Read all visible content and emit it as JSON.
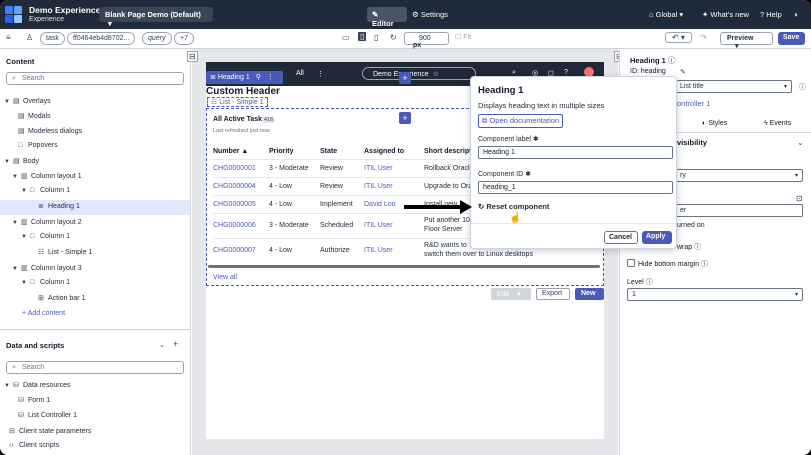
{
  "app": {
    "title": "Demo Experience",
    "subtitle": "Experience"
  },
  "topbar": {
    "page_select": "Blank Page Demo (Default)",
    "editor_label": "Editor",
    "settings_label": "Settings",
    "global_label": "Global",
    "whats_new_label": "What's new",
    "help_label": "Help"
  },
  "toolbar": {
    "pills": [
      "task",
      "ff0464eb4d8702...",
      "query",
      "+7"
    ],
    "zoom_value": "900",
    "zoom_unit": "px",
    "fit_label": "Fit",
    "preview_label": "Preview",
    "save_label": "Save"
  },
  "left_panel": {
    "content_heading": "Content",
    "search_placeholder": "Search",
    "tree": [
      {
        "label": "Overlays"
      },
      {
        "label": "Modals"
      },
      {
        "label": "Modeless dialogs"
      },
      {
        "label": "Popovers"
      },
      {
        "label": "Body"
      },
      {
        "label": "Column layout 1"
      },
      {
        "label": "Column 1"
      },
      {
        "label": "Heading 1"
      },
      {
        "label": "Column layout 2"
      },
      {
        "label": "Column 1"
      },
      {
        "label": "List - Simple 1"
      },
      {
        "label": "Column layout 3"
      },
      {
        "label": "Column 1"
      },
      {
        "label": "Action bar 1"
      }
    ],
    "add_content": "Add content",
    "data_heading": "Data and scripts",
    "data_search_placeholder": "Search",
    "data_tree": [
      {
        "label": "Data resources"
      },
      {
        "label": "Form 1"
      },
      {
        "label": "List Controller 1"
      },
      {
        "label": "Client state parameters"
      },
      {
        "label": "Client scripts"
      }
    ]
  },
  "canvas": {
    "header_text": "Custom Header",
    "nav_all": "All",
    "nav_pill": "Demo Experience",
    "sel_toolbar_label": "Heading 1",
    "list_label": "List - Simple 1",
    "table_title": "All Active Tasks",
    "table_count": "416",
    "refreshed": "Last refreshed just now",
    "columns": [
      "Number",
      "Priority",
      "State",
      "Assigned to",
      "Short descript"
    ],
    "rows": [
      {
        "number": "CHG0000001",
        "priority": "3 - Moderate",
        "state": "Review",
        "assigned": "ITIL User",
        "desc": "Rollback Oracle"
      },
      {
        "number": "CHG0000004",
        "priority": "4 - Low",
        "state": "Review",
        "assigned": "ITIL User",
        "desc": "Upgrade to Ora"
      },
      {
        "number": "CHG0000005",
        "priority": "4 - Low",
        "state": "Implement",
        "assigned": "David Loo",
        "desc": "Install new"
      },
      {
        "number": "CHG0000006",
        "priority": "3 - Moderate",
        "state": "Scheduled",
        "assigned": "ITIL User",
        "desc": "Put another 10",
        "desc2": "Floor Server"
      },
      {
        "number": "CHG0000007",
        "priority": "4 - Low",
        "state": "Authorize",
        "assigned": "ITIL User",
        "desc": "R&D wants to",
        "desc2": "switch them over to Linux desktops"
      }
    ],
    "view_all": "View all",
    "edit_label": "Edit",
    "export_label": "Export",
    "new_label": "New"
  },
  "right_panel": {
    "title": "Heading 1",
    "id_label": "ID: heading",
    "style_select": "List title",
    "list_controller": "ontroller 1",
    "tabs": [
      "Styles",
      "Events"
    ],
    "visibility": "visibility",
    "select2": "ry",
    "field3": "er",
    "turned_on": "urned on",
    "wrap_label": "wrap",
    "hide_bottom_margin": "Hide bottom margin",
    "level_label": "Level",
    "level_value": "1"
  },
  "popover": {
    "title": "Heading 1",
    "description": "Displays heading text in multiple sizes",
    "doc_link": "Open documentation",
    "label_field_label": "Component label",
    "label_value": "Heading 1",
    "id_field_label": "Component ID",
    "id_value": "heading_1",
    "reset_label": "Reset component",
    "cancel_label": "Cancel",
    "apply_label": "Apply"
  },
  "colors": {
    "topbar": "#1f2a3a",
    "accent": "#4b5ab8",
    "selection": "#e0e7ff"
  }
}
